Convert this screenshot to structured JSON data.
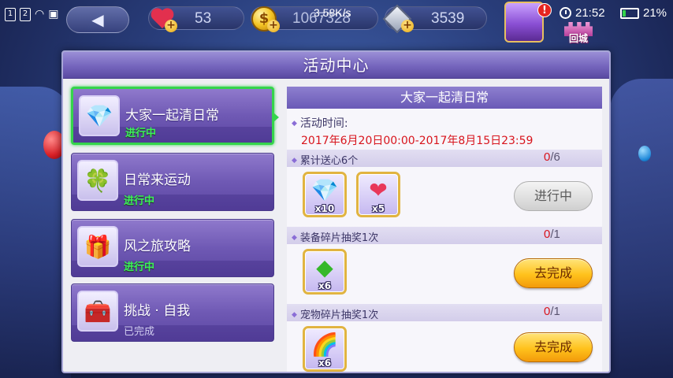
{
  "status_bar": {
    "sim1": "1",
    "sim2": "2",
    "net_speed": "3.58K/s",
    "time": "21:52",
    "battery_percent": "21%",
    "battery_level": 0.21
  },
  "resources": {
    "hearts": "53",
    "gold": "1067328",
    "diamonds": "3539"
  },
  "town_button": {
    "label": "回城"
  },
  "panel": {
    "title": "活动中心"
  },
  "activities": [
    {
      "name": "大家一起清日常",
      "status": "进行中",
      "icon": "purple-crystal-icon",
      "active": true
    },
    {
      "name": "日常来运动",
      "status": "进行中",
      "icon": "clover-icon",
      "active": false
    },
    {
      "name": "风之旅攻略",
      "status": "进行中",
      "icon": "gift-box-icon",
      "active": false
    },
    {
      "name": "挑战 · 自我",
      "status": "已完成",
      "icon": "gem-chest-icon",
      "active": false
    }
  ],
  "detail": {
    "title": "大家一起清日常",
    "time_label": "活动时间:",
    "time_value": "2017年6月20日00:00-2017年8月15日23:59",
    "tasks": [
      {
        "label": "累计送心6个",
        "current": "0",
        "total": "/6",
        "rewards": [
          {
            "icon": "purple-crystal-icon",
            "qty": "x10"
          },
          {
            "icon": "heart-icon",
            "qty": "x5"
          }
        ],
        "button": "进行中"
      },
      {
        "label": "装备碎片抽奖1次",
        "current": "0",
        "total": "/1",
        "rewards": [
          {
            "icon": "green-gem-icon",
            "qty": "x6"
          }
        ],
        "button": "去完成"
      },
      {
        "label": "宠物碎片抽奖1次",
        "current": "0",
        "total": "/1",
        "rewards": [
          {
            "icon": "rainbow-cloud-icon",
            "qty": "x6"
          }
        ],
        "button": "去完成"
      }
    ]
  },
  "colors": {
    "accent_green": "#35d44c",
    "count_red": "#d8141c",
    "panel_purple": "#7565bd",
    "button_gold": "#ffc21c"
  }
}
